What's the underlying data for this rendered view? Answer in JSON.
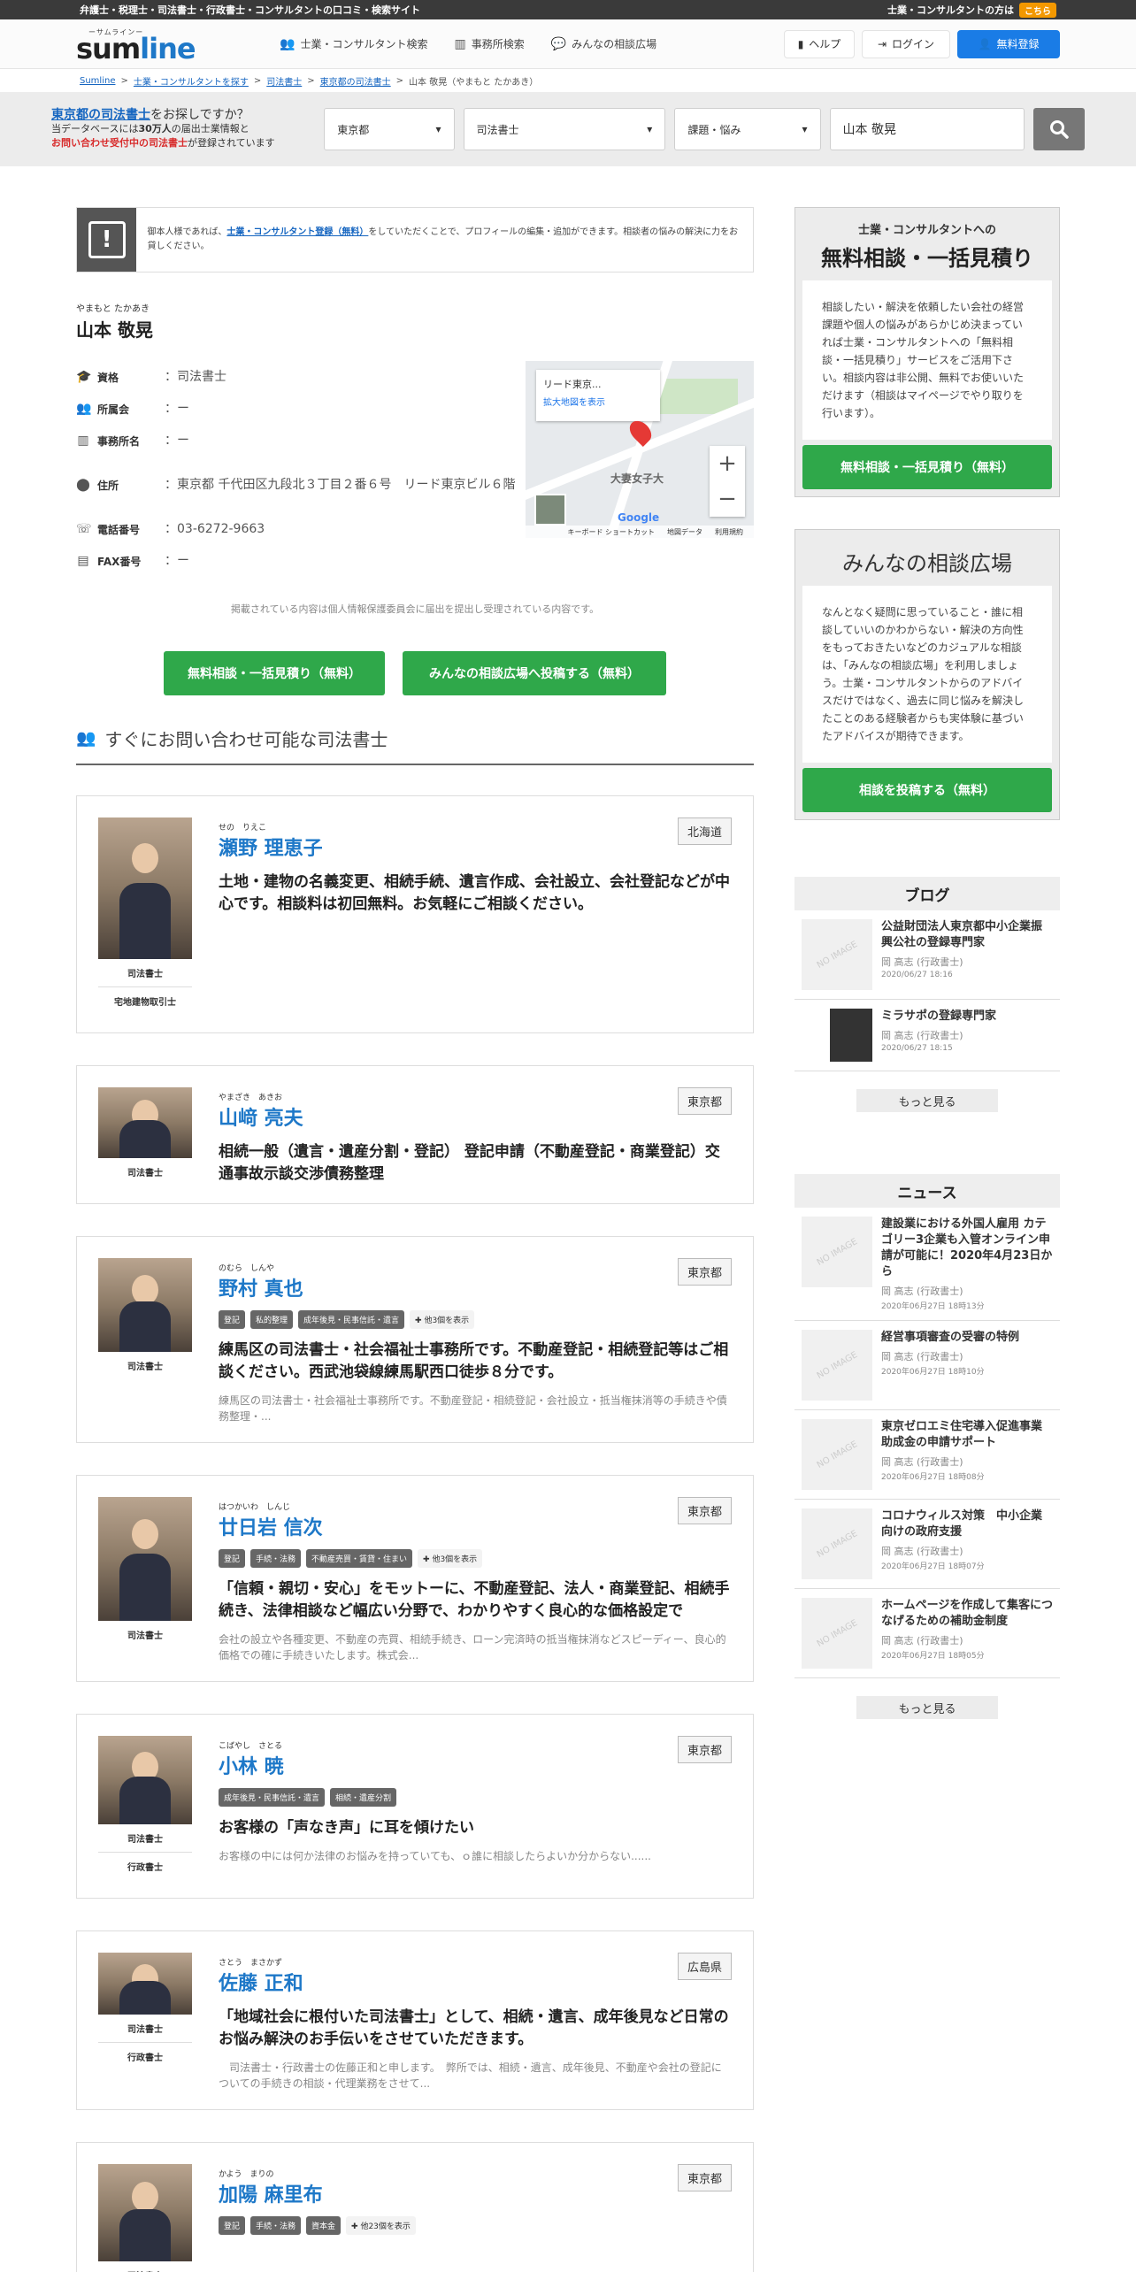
{
  "topbar": {
    "left": "弁護士・税理士・司法書士・行政書士・コンサルタントの口コミ・検索サイト",
    "right": "士業・コンサルタントの方は",
    "here": "こちら"
  },
  "header": {
    "logo_small": "ーサムラインー",
    "logo_text_main": "sum",
    "logo_text_accent": "line",
    "nav": [
      "士業・コンサルタント検索",
      "事務所検索",
      "みんなの相談広場"
    ],
    "help": "ヘルプ",
    "login": "ログイン",
    "register": "無料登録"
  },
  "breadcrumb": [
    "Sumline",
    "士業・コンサルタントを探す",
    "司法書士",
    "東京都の司法書士",
    "山本 敬晃（やまもと たかあき）"
  ],
  "search": {
    "q_link": "東京都の司法書士",
    "q_rest": "をお探しですか？",
    "line2a": "当データベースには",
    "line2b": "30万人",
    "line2c": "の届出士業情報と",
    "line3a": "お問い合わせ受付中の司法書士",
    "line3b": "が登録されています",
    "pref": "東京都",
    "kind": "司法書士",
    "topic": "課題・悩み",
    "keyword": "山本 敬晃"
  },
  "notice": {
    "pre": "御本人様であれば、",
    "link": "士業・コンサルタント登録（無料）",
    "post": "をしていただくことで、プロフィールの編集・追加ができます。相談者の悩みの解決に力をお貸しください。"
  },
  "profile": {
    "ruby": "やまもと たかあき",
    "name": "山本 敬晃",
    "rows": [
      {
        "label": "資格",
        "value": "：司法書士"
      },
      {
        "label": "所属会",
        "value": "：ー"
      },
      {
        "label": "事務所名",
        "value": "：ー"
      },
      {
        "label": "住所",
        "value": "：東京都 千代田区九段北３丁目２番６号　リード東京ビル６階"
      },
      {
        "label": "電話番号",
        "value": "：03-6272-9663"
      },
      {
        "label": "FAX番号",
        "value": "：ー"
      }
    ],
    "map": {
      "title": "リード東京...",
      "link": "拡大地図を表示",
      "place": "大妻女子大",
      "google": "Google",
      "foot1": "キーボード ショートカット",
      "foot2": "地図データ",
      "foot3": "利用規約"
    }
  },
  "disclaimer": "掲載されている内容は個人情報保護委員会に届出を提出し受理されている内容です。",
  "cta": {
    "a": "無料相談・一括見積り（無料）",
    "b": "みんなの相談広場へ投稿する（無料）"
  },
  "section_title": "すぐにお問い合わせ可能な司法書士",
  "cards": [
    {
      "ruby": "せの　りえこ",
      "name": "瀬野 理恵子",
      "pref": "北海道",
      "roles": [
        "司法書士",
        "宅地建物取引士"
      ],
      "tags": [],
      "catch": "土地・建物の名義変更、相続手続、遺言作成、会社設立、会社登記などが中心です。相談料は初回無料。お気軽にご相談ください。",
      "desc": "",
      "h": 160
    },
    {
      "ruby": "やまざき　あきお",
      "name": "山﨑 亮夫",
      "pref": "東京都",
      "roles": [
        "司法書士"
      ],
      "tags": [],
      "catch": "相続一般（遺言・遺産分割・登記） 登記申請（不動産登記・商業登記）交通事故示談交渉債務整理",
      "desc": "",
      "h": 80
    },
    {
      "ruby": "のむら　しんや",
      "name": "野村 真也",
      "pref": "東京都",
      "roles": [
        "司法書士"
      ],
      "tags": [
        "登記",
        "私的整理",
        "成年後見・民事信託・遺言",
        "✚ 他3個を表示"
      ],
      "catch": "練馬区の司法書士・社会福祉士事務所です。不動産登記・相続登記等はご相談ください。西武池袋線練馬駅西口徒歩８分です。",
      "desc": "練馬区の司法書士・社会福祉士事務所です。不動産登記・相続登記・会社設立・抵当権抹消等の手続きや債務整理・...",
      "h": 106
    },
    {
      "ruby": "はつかいわ　しんじ",
      "name": "廿日岩 信次",
      "pref": "東京都",
      "roles": [
        "司法書士"
      ],
      "tags": [
        "登記",
        "手続・法務",
        "不動産売買・賃貸・住まい",
        "✚ 他3個を表示"
      ],
      "catch": "「信頼・親切・安心」をモットーに、不動産登記、法人・商業登記、相続手続き、法律相談など幅広い分野で、わかりやすく良心的な価格設定で",
      "desc": "会社の設立や各種変更、不動産の売買、相続手続き、ローン完済時の抵当権抹消などスピーディー、良心的価格での確に手続きいたします。株式会...",
      "h": 140
    },
    {
      "ruby": "こばやし　さとる",
      "name": "小林 暁",
      "pref": "東京都",
      "roles": [
        "司法書士",
        "行政書士"
      ],
      "tags": [
        "成年後見・民事信託・遺言",
        "相続・遺産分割"
      ],
      "catch": "お客様の「声なき声」に耳を傾けたい",
      "desc": "お客様の中には何か法律のお悩みを持っていても、ｏ誰に相談したらよいか分からない......",
      "h": 100
    },
    {
      "ruby": "さとう　まさかず",
      "name": "佐藤 正和",
      "pref": "広島県",
      "roles": [
        "司法書士",
        "行政書士"
      ],
      "tags": [],
      "catch": "「地域社会に根付いた司法書士」として、相続・遺言、成年後見など日常のお悩み解決のお手伝いをさせていただきます。",
      "desc": "　司法書士・行政書士の佐藤正和と申します。　弊所では、相続・遺言、成年後見、不動産や会社の登記についての手続きの相談・代理業務をさせて...",
      "h": 70
    },
    {
      "ruby": "かよう　まりの",
      "name": "加陽 麻里布",
      "pref": "東京都",
      "roles": [
        "司法書士"
      ],
      "tags": [
        "登記",
        "手続・法務",
        "資本金",
        "✚ 他23個を表示"
      ],
      "catch": "",
      "desc": "",
      "h": 110
    }
  ],
  "sidebar": {
    "box1": {
      "h1": "士業・コンサルタントへの",
      "h2": "無料相談・一括見積り",
      "text": "相談したい・解決を依頼したい会社の経営課題や個人の悩みがあらかじめ決まっていれば士業・コンサルタントへの「無料相談・一括見積り」サービスをご活用下さい。相談内容は非公開、無料でお使いいただけます（相談はマイページでやり取りを行います）。",
      "btn": "無料相談・一括見積り（無料）"
    },
    "box2": {
      "h": "みんなの相談広場",
      "text": "なんとなく疑問に思っていること・誰に相談していいのかわからない・解決の方向性をもっておきたいなどのカジュアルな相談は、「みんなの相談広場」を利用しましょう。士業・コンサルタントからのアドバイスだけではなく、過去に同じ悩みを解決したことのある経験者からも実体験に基づいたアドバイスが期待できます。",
      "btn": "相談を投稿する（無料）"
    },
    "blog": {
      "title": "ブログ",
      "items": [
        {
          "title": "公益財団法人東京都中小企業振興公社の登録専門家",
          "author": "岡 高志 (行政書士)",
          "date": "2020/06/27 18:16"
        },
        {
          "title": "ミラサポの登録専門家",
          "author": "岡 高志 (行政書士)",
          "date": "2020/06/27 18:15"
        }
      ],
      "more": "もっと見る"
    },
    "news": {
      "title": "ニュース",
      "items": [
        {
          "title": "建設業における外国人雇用 カテゴリー3企業も入管オンライン申請が可能に！2020年4月23日から",
          "author": "岡 高志 (行政書士)",
          "date": "2020年06月27日 18時13分"
        },
        {
          "title": "経営事項審査の受審の特例",
          "author": "岡 高志 (行政書士)",
          "date": "2020年06月27日 18時10分"
        },
        {
          "title": "東京ゼロエミ住宅導入促進事業　助成金の申請サポート",
          "author": "岡 高志 (行政書士)",
          "date": "2020年06月27日 18時08分"
        },
        {
          "title": "コロナウィルス対策　中小企業向けの政府支援",
          "author": "岡 高志 (行政書士)",
          "date": "2020年06月27日 18時07分"
        },
        {
          "title": "ホームページを作成して集客につなげるための補助金制度",
          "author": "岡 高志 (行政書士)",
          "date": "2020年06月27日 18時05分"
        }
      ],
      "more": "もっと見る"
    },
    "noimage": "NO IMAGE"
  }
}
